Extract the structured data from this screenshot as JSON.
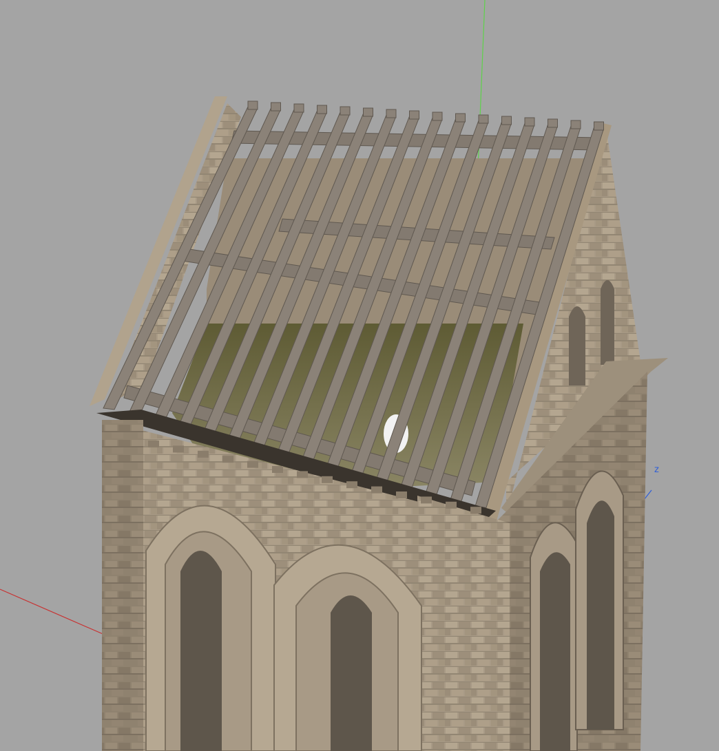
{
  "viewport": {
    "background": "#a4a4a4",
    "axes": {
      "x_color": "#c83232",
      "y_color": "#5ed24a",
      "z_color": "#2f5fd8",
      "z_label": "z"
    }
  },
  "model": {
    "stone_color": "#a69783",
    "stone_dark": "#6f6558",
    "timber_color": "#867d73",
    "moss_color": "#6e6a3a"
  }
}
